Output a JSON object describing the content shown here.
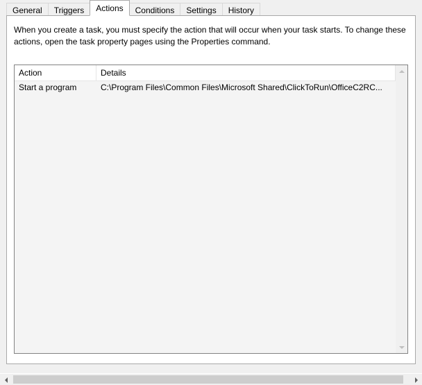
{
  "tabs": {
    "general": {
      "label": "General"
    },
    "triggers": {
      "label": "Triggers"
    },
    "actions": {
      "label": "Actions"
    },
    "conditions": {
      "label": "Conditions"
    },
    "settings": {
      "label": "Settings"
    },
    "history": {
      "label": "History"
    }
  },
  "active_tab": "actions",
  "description": "When you create a task, you must specify the action that will occur when your task starts.  To change these actions, open the task property pages using the Properties command.",
  "columns": {
    "action": {
      "label": "Action"
    },
    "details": {
      "label": "Details"
    }
  },
  "rows": [
    {
      "action": "Start a program",
      "details": "C:\\Program Files\\Common Files\\Microsoft Shared\\ClickToRun\\OfficeC2RC..."
    }
  ]
}
